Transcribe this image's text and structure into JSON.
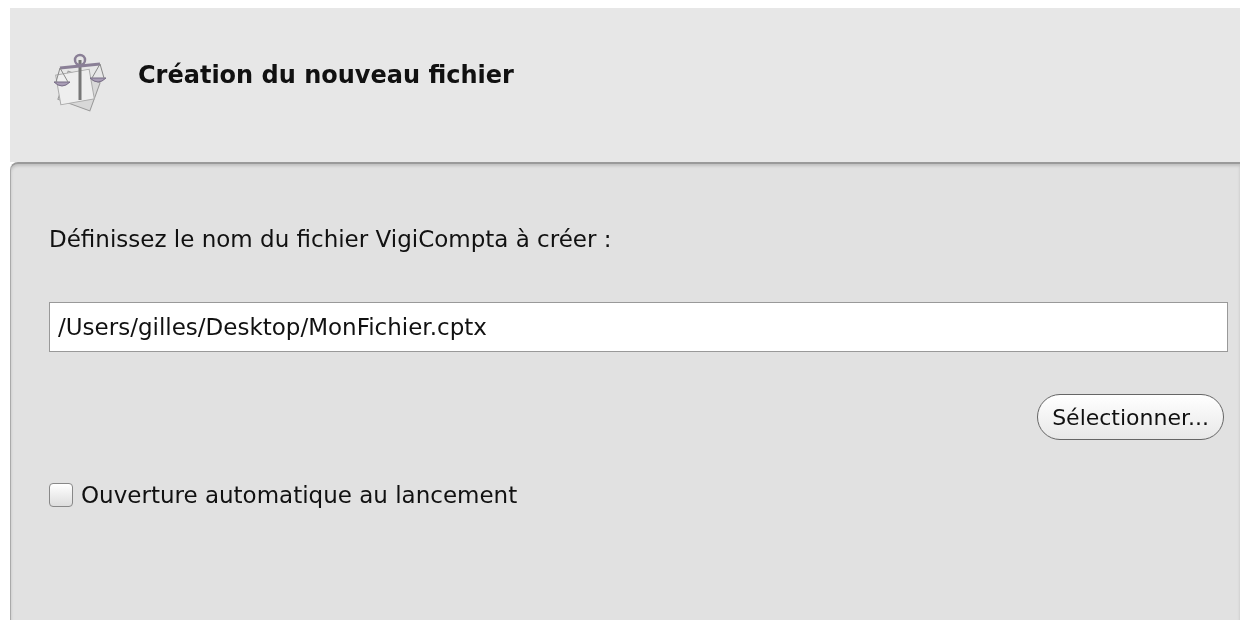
{
  "header": {
    "title": "Création du nouveau fichier"
  },
  "prompt": "Définissez le nom du fichier VigiCompta à créer :",
  "path_field": {
    "value": "/Users/gilles/Desktop/MonFichier.cptx"
  },
  "select_button": "Sélectionner...",
  "auto_open": {
    "label": "Ouverture automatique au lancement",
    "checked": false
  }
}
